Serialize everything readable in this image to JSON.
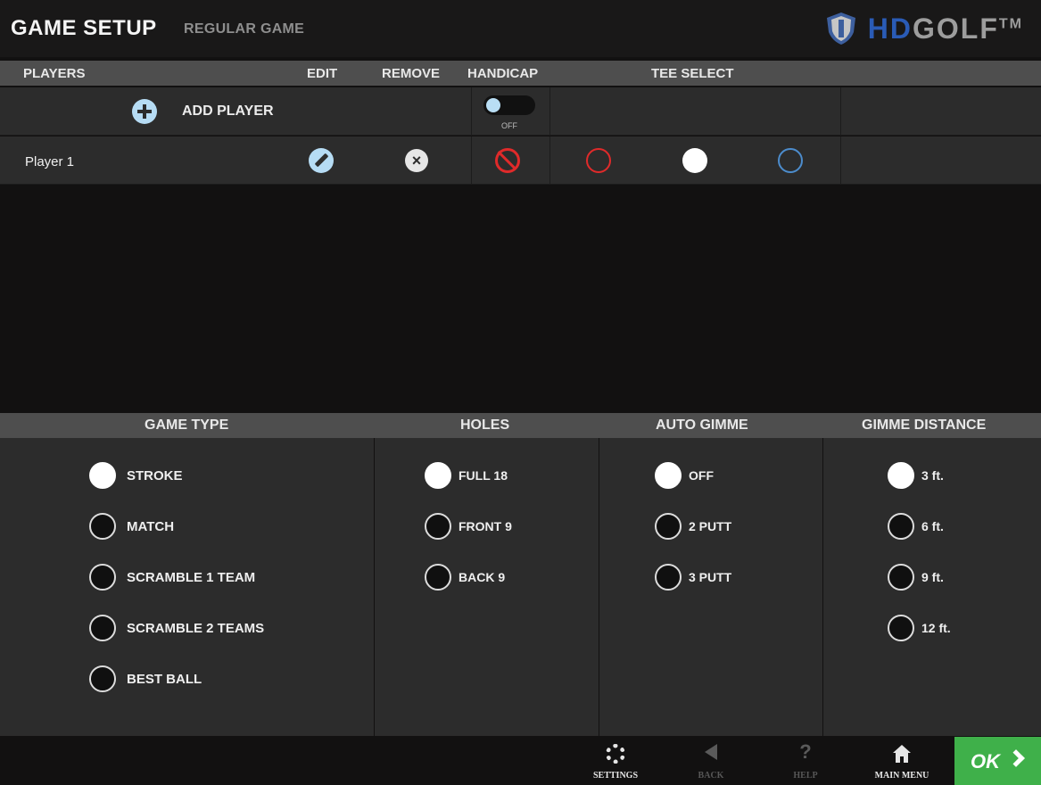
{
  "header": {
    "title": "GAME SETUP",
    "subtitle": "REGULAR GAME",
    "logo": {
      "hd": "HD",
      "golf": "GOLF",
      "tm": "TM"
    }
  },
  "players_table": {
    "columns": {
      "players": "PLAYERS",
      "edit": "EDIT",
      "remove": "REMOVE",
      "handicap": "HANDICAP",
      "tee_select": "TEE SELECT"
    },
    "add_player_label": "ADD PLAYER",
    "handicap_toggle": {
      "label": "OFF",
      "state": "off"
    },
    "rows": [
      {
        "name": "Player 1",
        "tees": [
          "red",
          "white",
          "blue"
        ],
        "selected_tee": "white"
      }
    ]
  },
  "options": {
    "game_type": {
      "header": "GAME TYPE",
      "items": [
        "STROKE",
        "MATCH",
        "SCRAMBLE 1 TEAM",
        "SCRAMBLE 2 TEAMS",
        "BEST BALL"
      ],
      "selected": "STROKE"
    },
    "holes": {
      "header": "HOLES",
      "items": [
        "FULL 18",
        "FRONT 9",
        "BACK 9"
      ],
      "selected": "FULL 18"
    },
    "auto_gimme": {
      "header": "AUTO GIMME",
      "items": [
        "OFF",
        "2 PUTT",
        "3 PUTT"
      ],
      "selected": "OFF"
    },
    "gimme_distance": {
      "header": "GIMME DISTANCE",
      "items": [
        "3 ft.",
        "6 ft.",
        "9 ft.",
        "12 ft."
      ],
      "selected": "3 ft."
    }
  },
  "footer": {
    "settings": "SETTINGS",
    "back": "BACK",
    "help": "HELP",
    "main_menu": "MAIN MENU",
    "ok": "OK"
  },
  "colors": {
    "accent_green": "#3fb04a",
    "tee_red": "#e02a2a",
    "tee_white": "#ffffff",
    "tee_blue": "#4c8ccc",
    "icon_light_blue": "#b6dcf4"
  }
}
